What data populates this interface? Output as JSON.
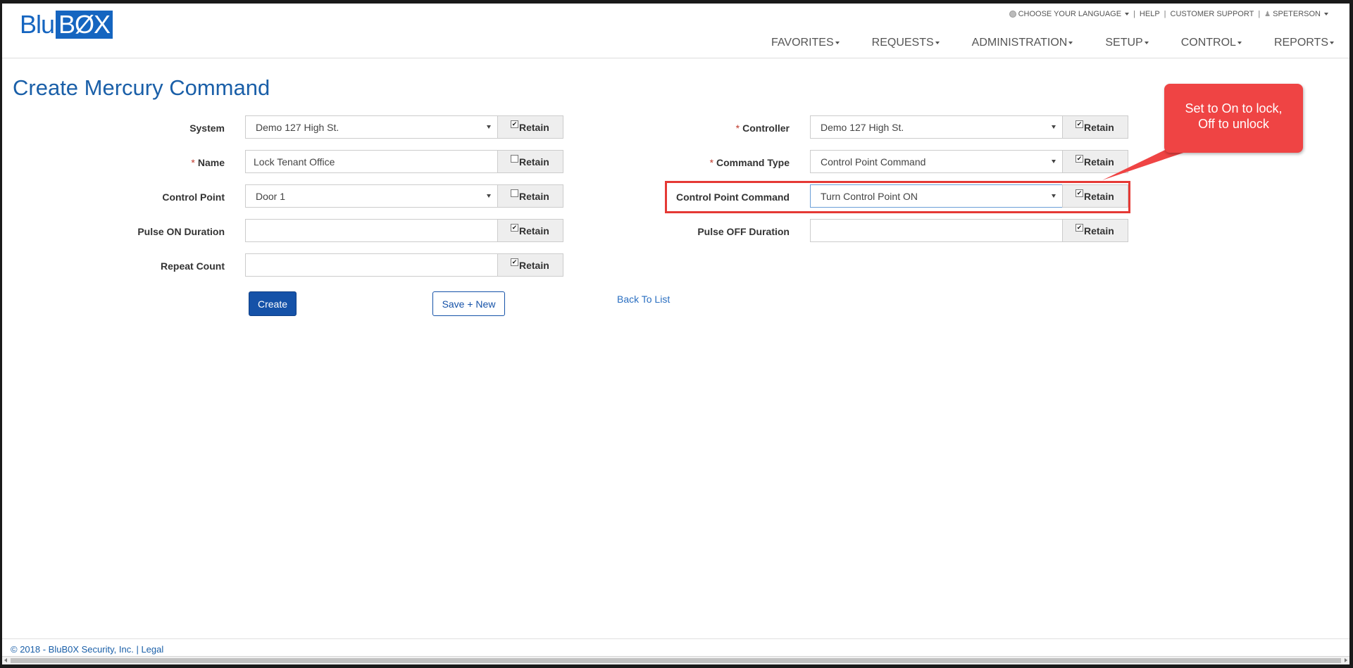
{
  "logo": {
    "part1": "Blu",
    "part2": "BØX"
  },
  "utility": {
    "language": "CHOOSE YOUR LANGUAGE",
    "help": "HELP",
    "support": "CUSTOMER SUPPORT",
    "user": "SPETERSON",
    "separator": "|"
  },
  "nav": [
    "FAVORITES",
    "REQUESTS",
    "ADMINISTRATION",
    "SETUP",
    "CONTROL",
    "REPORTS"
  ],
  "page_title": "Create Mercury Command",
  "left_fields": [
    {
      "label": "System",
      "required": false,
      "value": "Demo 127 High St.",
      "type": "select",
      "retain": true
    },
    {
      "label": "Name",
      "required": true,
      "value": "Lock Tenant Office",
      "type": "input",
      "retain": false
    },
    {
      "label": "Control Point",
      "required": false,
      "value": "Door 1",
      "type": "select",
      "retain": false
    },
    {
      "label": "Pulse ON Duration",
      "required": false,
      "value": "",
      "type": "input",
      "retain": true
    },
    {
      "label": "Repeat Count",
      "required": false,
      "value": "",
      "type": "input",
      "retain": true
    }
  ],
  "right_fields": [
    {
      "label": "Controller",
      "required": true,
      "value": "Demo 127 High St.",
      "type": "select",
      "retain": true
    },
    {
      "label": "Command Type",
      "required": true,
      "value": "Control Point Command",
      "type": "select",
      "retain": true
    },
    {
      "label": "Control Point Command",
      "required": false,
      "value": "Turn Control Point ON",
      "type": "select",
      "retain": true
    },
    {
      "label": "Pulse OFF Duration",
      "required": false,
      "value": "",
      "type": "input",
      "retain": true
    }
  ],
  "required_mark": "*",
  "retain_label": "Retain",
  "buttons": {
    "create": "Create",
    "save_new": "Save + New",
    "back": "Back To List"
  },
  "callout": {
    "line1": "Set to On to lock,",
    "line2": "Off to unlock"
  },
  "footer": {
    "copyright": "© 2018 - BluB0X Security, Inc.",
    "separator": "|",
    "legal": "Legal"
  },
  "colors": {
    "brand": "#1565c0",
    "callout": "#ef4444",
    "link": "#2a6fc1"
  }
}
